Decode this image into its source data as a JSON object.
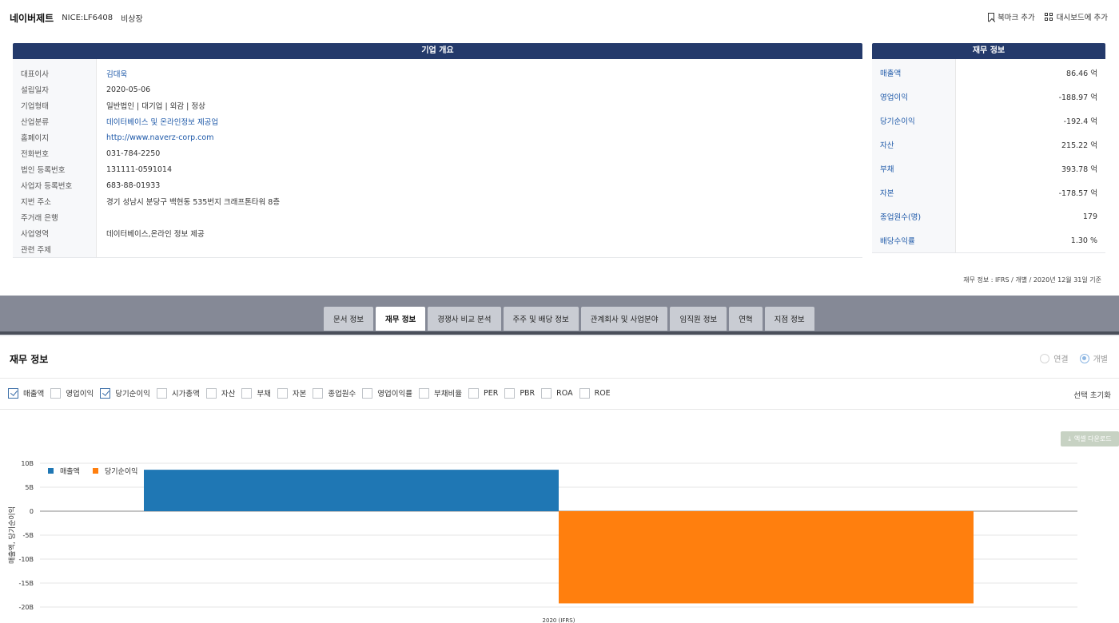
{
  "company": {
    "name": "네이버제트",
    "code": "NICE:LF6408",
    "listing": "비상장"
  },
  "actions": {
    "bookmark": "북마크 추가",
    "dashboard": "대시보드에 추가"
  },
  "overview": {
    "title": "기업 개요",
    "rows": [
      {
        "label": "대표이사",
        "value": "김대욱",
        "link": true
      },
      {
        "label": "설립일자",
        "value": "2020-05-06",
        "link": false
      },
      {
        "label": "기업형태",
        "value": "일반법인 | 대기업 | 외감 | 정상",
        "link": false
      },
      {
        "label": "산업분류",
        "value": "데이터베이스 및 온라인정보 제공업",
        "link": true
      },
      {
        "label": "홈페이지",
        "value": "http://www.naverz-corp.com",
        "link": true
      },
      {
        "label": "전화번호",
        "value": "031-784-2250",
        "link": false
      },
      {
        "label": "법인 등록번호",
        "value": "131111-0591014",
        "link": false
      },
      {
        "label": "사업자 등록번호",
        "value": "683-88-01933",
        "link": false
      },
      {
        "label": "지번 주소",
        "value": "경기 성남시 분당구 백현동 535번지 크래프톤타워 8층",
        "link": false
      },
      {
        "label": "주거래 은행",
        "value": "",
        "link": false
      },
      {
        "label": "사업영역",
        "value": "데이터베이스,온라인 정보 제공",
        "link": false
      },
      {
        "label": "관련 주제",
        "value": "",
        "link": false
      }
    ]
  },
  "financial_info": {
    "title": "재무 정보",
    "rows": [
      {
        "label": "매출액",
        "value": "86.46 억"
      },
      {
        "label": "영업이익",
        "value": "-188.97 억"
      },
      {
        "label": "당기순이익",
        "value": "-192.4 억"
      },
      {
        "label": "자산",
        "value": "215.22 억"
      },
      {
        "label": "부채",
        "value": "393.78 억"
      },
      {
        "label": "자본",
        "value": "-178.57 억"
      },
      {
        "label": "종업원수(명)",
        "value": "179"
      },
      {
        "label": "배당수익률",
        "value": "1.30 %"
      }
    ],
    "note": "재무 정보 : IFRS / 개별 / 2020년 12월 31일 기준"
  },
  "tabs": [
    {
      "label": "문서 정보",
      "active": false
    },
    {
      "label": "재무 정보",
      "active": true
    },
    {
      "label": "경쟁사 비교 분석",
      "active": false
    },
    {
      "label": "주주 및 배당 정보",
      "active": false
    },
    {
      "label": "관계회사 및 사업분야",
      "active": false
    },
    {
      "label": "임직원 정보",
      "active": false
    },
    {
      "label": "연혁",
      "active": false
    },
    {
      "label": "지점 정보",
      "active": false
    }
  ],
  "fin_section": {
    "title": "재무 정보",
    "radio_consolidated": "연결",
    "radio_separate": "개별",
    "selected": "개별",
    "reset": "선택 초기화",
    "excel": "엑셀 다운로드",
    "checkboxes": [
      {
        "label": "매출액",
        "checked": true
      },
      {
        "label": "영업이익",
        "checked": false
      },
      {
        "label": "당기순이익",
        "checked": true
      },
      {
        "label": "시가총액",
        "checked": false
      },
      {
        "label": "자산",
        "checked": false
      },
      {
        "label": "부채",
        "checked": false
      },
      {
        "label": "자본",
        "checked": false
      },
      {
        "label": "종업원수",
        "checked": false
      },
      {
        "label": "영업이익률",
        "checked": false
      },
      {
        "label": "부채비율",
        "checked": false
      },
      {
        "label": "PER",
        "checked": false
      },
      {
        "label": "PBR",
        "checked": false
      },
      {
        "label": "ROA",
        "checked": false
      },
      {
        "label": "ROE",
        "checked": false
      }
    ]
  },
  "chart_data": {
    "type": "bar",
    "categories": [
      "2020 (IFRS)"
    ],
    "series": [
      {
        "name": "매출액",
        "values": [
          8.646
        ],
        "color": "#1f77b4"
      },
      {
        "name": "당기순이익",
        "values": [
          -19.24
        ],
        "color": "#ff7f0e"
      }
    ],
    "ylabel": "매출액, 당기순이익",
    "ylim": [
      -20,
      10
    ],
    "yticks": [
      "10B",
      "5B",
      "0",
      "-5B",
      "-10B",
      "-15B",
      "-20B"
    ],
    "ytick_values": [
      10,
      5,
      0,
      -5,
      -10,
      -15,
      -20
    ],
    "legend": "top-left",
    "grid": true
  }
}
